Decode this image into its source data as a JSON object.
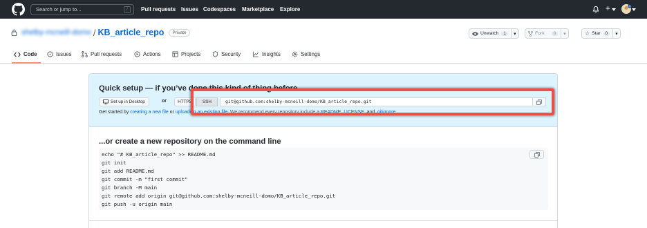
{
  "header": {
    "search_placeholder": "Search or jump to...",
    "search_shortcut": "/",
    "nav": [
      "Pull requests",
      "Issues",
      "Codespaces",
      "Marketplace",
      "Explore"
    ],
    "plus_label": "+"
  },
  "repo": {
    "owner": "shelby-mcneill-domo",
    "separator": "/",
    "name": "KB_article_repo",
    "visibility": "Private",
    "unwatch_label": "Unwatch",
    "watch_count": "1",
    "fork_label": "Fork",
    "fork_count": "0",
    "star_label": "Star",
    "star_count": "0"
  },
  "tabs": [
    "Code",
    "Issues",
    "Pull requests",
    "Actions",
    "Projects",
    "Security",
    "Insights",
    "Settings"
  ],
  "quick_setup": {
    "title": "Quick setup — if you’ve done this kind of thing before",
    "desktop_button": "Set up in Desktop",
    "or_label": "or",
    "protocols": [
      "HTTPS",
      "SSH"
    ],
    "clone_url": "git@github.com:shelby-mcneill-domo/KB_article_repo.git",
    "get_started_prefix": "Get started by ",
    "create_file_link": "creating a new file",
    "or_text": " or ",
    "upload_link": "uploading an existing file",
    "recommend_text": ". We recommend every repository include a ",
    "readme_link": "README",
    "comma": ", ",
    "license_link": "LICENSE",
    "and_text": ", and ",
    "gitignore_link": ".gitignore",
    "period": "."
  },
  "command_line": {
    "title": "...or create a new repository on the command line",
    "lines": [
      "echo \"# KB_article_repo\" >> README.md",
      "git init",
      "git add README.md",
      "git commit -m \"first commit\"",
      "git branch -M main",
      "git remote add origin git@github.com:shelby-mcneill-domo/KB_article_repo.git",
      "git push -u origin main"
    ]
  },
  "colors": {
    "header_bg": "#24292f",
    "link": "#0969da",
    "quick_setup_bg": "#ddf4ff",
    "active_tab_underline": "#fd8c73",
    "highlight": "#e8524b"
  }
}
